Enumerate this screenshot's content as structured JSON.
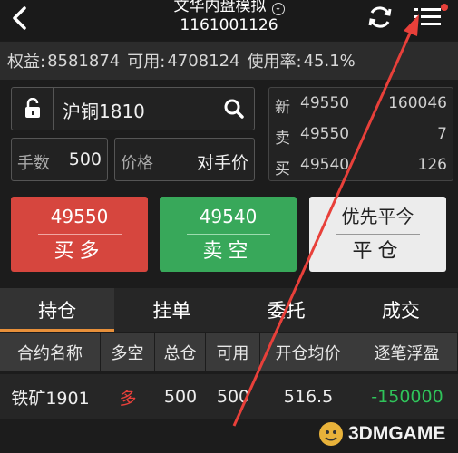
{
  "header": {
    "title_line1": "文华内盘模拟",
    "title_line2": "1161001126",
    "dropdown_glyph": "⌄",
    "back_icon": "chevron-left-icon",
    "refresh_icon": "refresh-icon",
    "menu_icon": "menu-list-icon"
  },
  "account": {
    "equity_label": "权益:",
    "equity_value": "8581874",
    "available_label": "可用:",
    "available_value": "4708124",
    "usage_label": "使用率:",
    "usage_value": "45.1%"
  },
  "order": {
    "contract": "沪铜1810",
    "qty_label": "手数",
    "qty_value": "500",
    "price_label": "价格",
    "price_value": "对手价"
  },
  "quote": {
    "rows": [
      {
        "label": "新",
        "price": "49550",
        "volume": "160046"
      },
      {
        "label": "卖",
        "price": "49550",
        "volume": "7"
      },
      {
        "label": "买",
        "price": "49540",
        "volume": "126"
      }
    ]
  },
  "buttons": {
    "buy_price": "49550",
    "buy_label": "买多",
    "sell_price": "49540",
    "sell_label": "卖空",
    "close_top": "优先平今",
    "close_label": "平仓"
  },
  "tabs": [
    "持仓",
    "挂单",
    "委托",
    "成交"
  ],
  "positions": {
    "headers": [
      "合约名称",
      "多空",
      "总仓",
      "可用",
      "开仓均价",
      "逐笔浮盈"
    ],
    "rows": [
      {
        "name": "铁矿1901",
        "side": "多",
        "total": "500",
        "available": "500",
        "avg_price": "516.5",
        "pnl": "-150000"
      }
    ]
  },
  "watermark": {
    "text": "3DMGAME"
  },
  "colors": {
    "buy": "#d6463e",
    "sell": "#38a85a",
    "accent": "#e8903a",
    "annotation_arrow": "#e8403a"
  }
}
